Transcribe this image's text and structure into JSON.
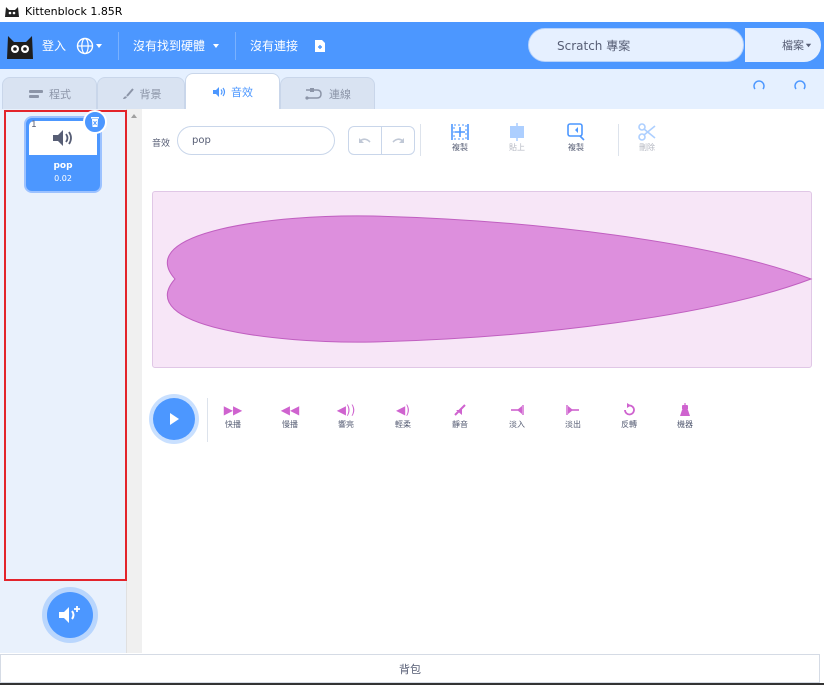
{
  "window": {
    "title": "Kittenblock 1.85R"
  },
  "menubar": {
    "login": "登入",
    "no_hardware": "沒有找到硬體",
    "no_connection": "沒有連接",
    "project_title": "Scratch 專案",
    "file_menu": "檔案"
  },
  "tabs": [
    {
      "label": "程式"
    },
    {
      "label": "背景"
    },
    {
      "label": "音效"
    },
    {
      "label": "連線"
    }
  ],
  "sound_list": {
    "items": [
      {
        "index": "1",
        "name": "pop",
        "duration": "0.02"
      }
    ]
  },
  "editor": {
    "name_label": "音效",
    "name_value": "pop",
    "tools": [
      {
        "label": "複製"
      },
      {
        "label": "貼上"
      },
      {
        "label": "複製"
      },
      {
        "label": "刪除"
      }
    ],
    "effects": [
      {
        "label": "快播"
      },
      {
        "label": "慢播"
      },
      {
        "label": "響亮"
      },
      {
        "label": "輕柔"
      },
      {
        "label": "靜音"
      },
      {
        "label": "淡入"
      },
      {
        "label": "淡出"
      },
      {
        "label": "反轉"
      },
      {
        "label": "機器"
      }
    ]
  },
  "backpack": {
    "label": "背包"
  },
  "colors": {
    "accent": "#4c97ff",
    "sound": "#cf63cf",
    "waveform": "#dd8fdd",
    "highlight": "#e3242b"
  }
}
